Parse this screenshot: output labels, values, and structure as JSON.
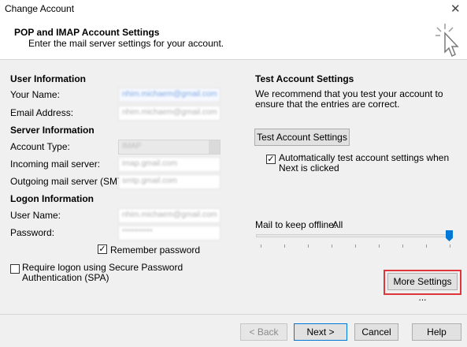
{
  "window": {
    "title": "Change Account",
    "close_glyph": "✕"
  },
  "header": {
    "title": "POP and IMAP Account Settings",
    "subtitle": "Enter the mail server settings for your account.",
    "icon": "cursor-click-icon"
  },
  "user_info": {
    "heading": "User Information",
    "your_name_label": "Your Name:",
    "your_name_value": "nhim.michaem@gmail.com",
    "email_label": "Email Address:",
    "email_value": "nhim.michaem@gmail.com"
  },
  "server_info": {
    "heading": "Server Information",
    "account_type_label": "Account Type:",
    "account_type_value": "IMAP",
    "incoming_label": "Incoming mail server:",
    "incoming_value": "imap.gmail.com",
    "outgoing_label": "Outgoing mail server (SMTP):",
    "outgoing_value": "smtp.gmail.com"
  },
  "logon_info": {
    "heading": "Logon Information",
    "username_label": "User Name:",
    "username_value": "nhim.michaem@gmail.com",
    "password_label": "Password:",
    "password_value": "**********",
    "remember_label": "Remember password",
    "remember_checked": "✓",
    "spa_label": "Require logon using Secure Password Authentication (SPA)"
  },
  "test_settings": {
    "heading": "Test Account Settings",
    "description": "We recommend that you test your account to ensure that the entries are correct.",
    "test_button": "Test Account Settings ...",
    "auto_test_label": "Automatically test account settings when Next is clicked",
    "auto_test_checked": "✓"
  },
  "offline": {
    "label": "Mail to keep offline:",
    "value": "All",
    "slider_level": 1.0
  },
  "more_settings_button": "More Settings ...",
  "footer": {
    "back": "< Back",
    "next": "Next >",
    "cancel": "Cancel",
    "help": "Help"
  },
  "colors": {
    "accent": "#0078d7",
    "highlight_border": "#e0353b"
  }
}
